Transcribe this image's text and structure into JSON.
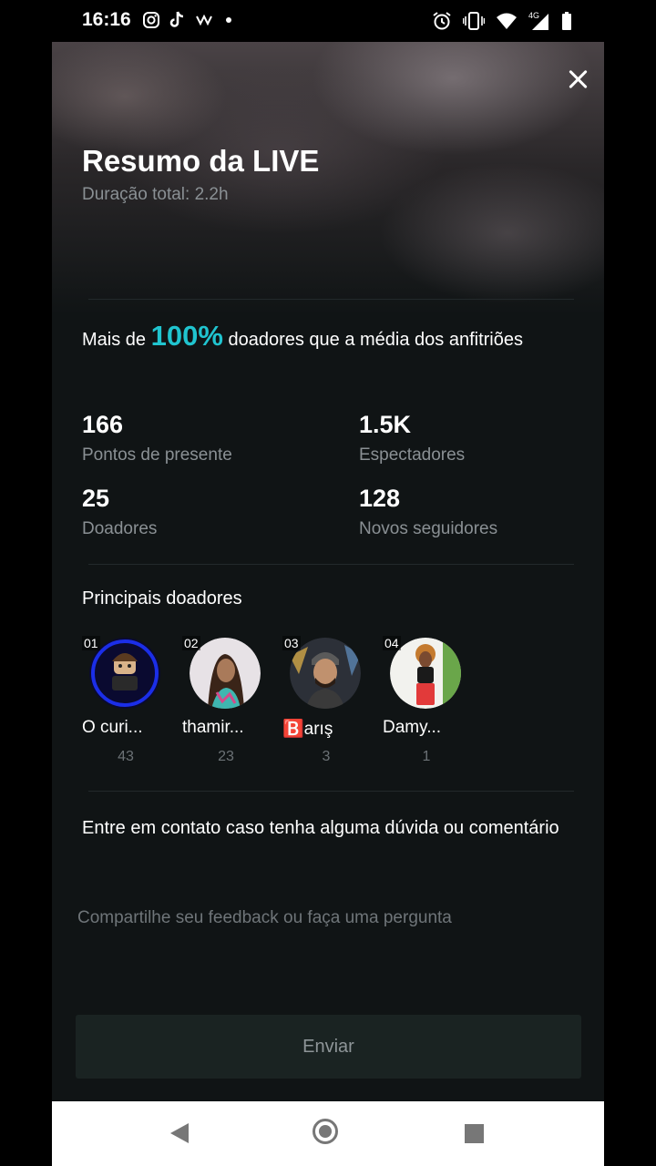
{
  "status_bar": {
    "time": "16:16",
    "left_icons": [
      "instagram-icon",
      "tiktok-icon",
      "app-icon",
      "dot-icon"
    ],
    "right_icons": [
      "alarm-icon",
      "vibrate-icon",
      "wifi-icon",
      "signal-4g-icon",
      "battery-icon"
    ],
    "network": "4G"
  },
  "summary": {
    "title": "Resumo da LIVE",
    "duration": "Duração total: 2.2h"
  },
  "comparison": {
    "prefix": "Mais de",
    "percent": "100%",
    "suffix": "doadores que a média dos anfitriões",
    "accent_color": "#20c4cf"
  },
  "stats": [
    {
      "value": "166",
      "label": "Pontos de presente"
    },
    {
      "value": "1.5K",
      "label": "Espectadores"
    },
    {
      "value": "25",
      "label": "Doadores"
    },
    {
      "value": "128",
      "label": "Novos seguidores"
    }
  ],
  "top_donors": {
    "title": "Principais doadores",
    "donors": [
      {
        "rank": "01",
        "name": "O curi...",
        "count": "43"
      },
      {
        "rank": "02",
        "name": "thamir...",
        "count": "23"
      },
      {
        "rank": "03",
        "name": "🅱️arış",
        "count": "3"
      },
      {
        "rank": "04",
        "name": "Damy...",
        "count": "1"
      }
    ]
  },
  "contact": {
    "text": "Entre em contato caso tenha alguma dúvida ou comentário",
    "placeholder": "Compartilhe seu feedback ou faça uma pergunta",
    "send_label": "Enviar"
  }
}
